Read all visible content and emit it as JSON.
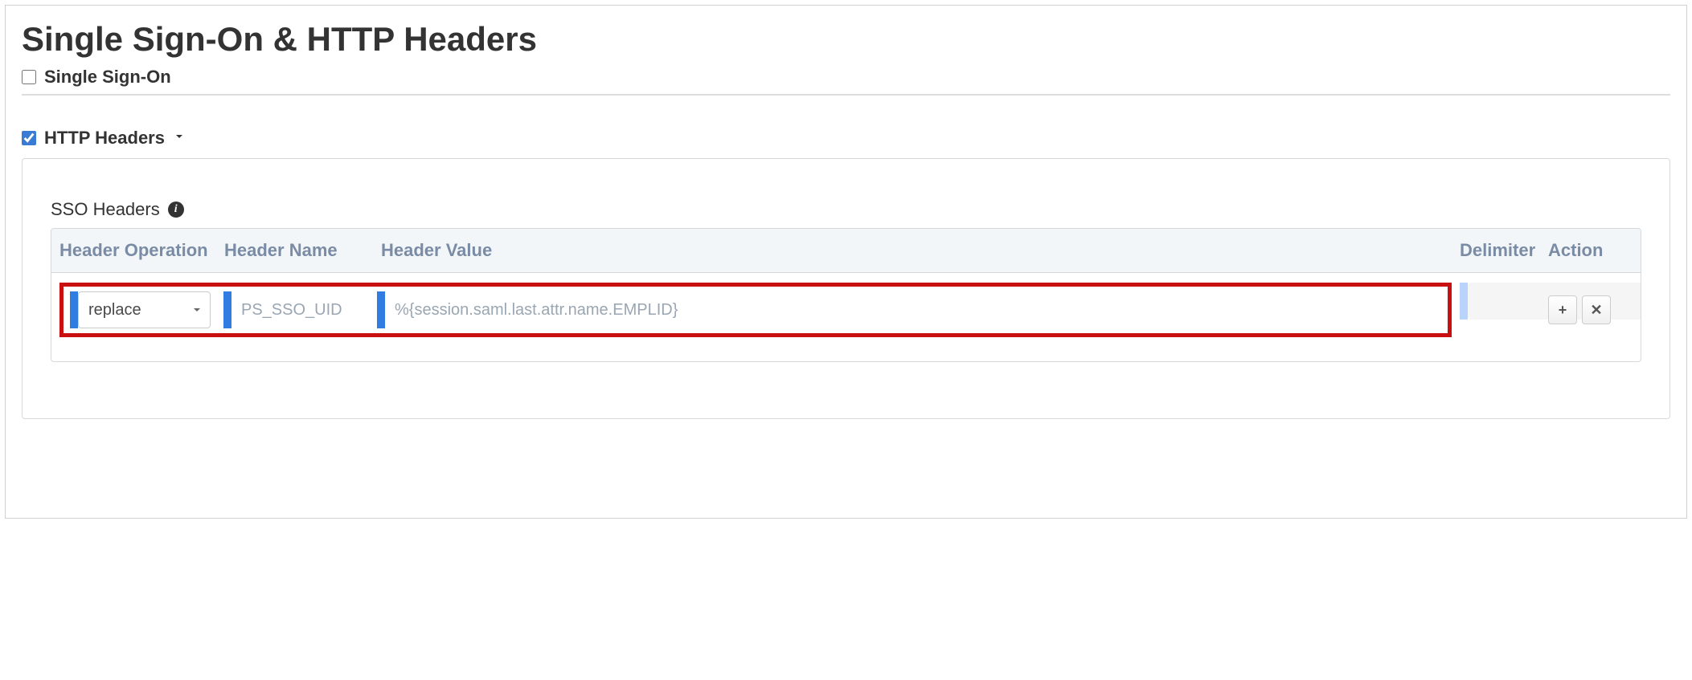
{
  "page": {
    "title": "Single Sign-On & HTTP Headers"
  },
  "sections": {
    "sso": {
      "label": "Single Sign-On",
      "checked": false
    },
    "http_headers": {
      "label": "HTTP Headers",
      "checked": true
    }
  },
  "sso_headers": {
    "title": "SSO Headers",
    "columns": {
      "operation": "Header Operation",
      "name": "Header Name",
      "value": "Header Value",
      "delimiter": "Delimiter",
      "action": "Action"
    },
    "rows": [
      {
        "operation": "replace",
        "name": "PS_SSO_UID",
        "value": "%{session.saml.last.attr.name.EMPLID}",
        "delimiter": ""
      }
    ]
  },
  "icons": {
    "info": "i",
    "plus": "+",
    "remove": "✕"
  }
}
